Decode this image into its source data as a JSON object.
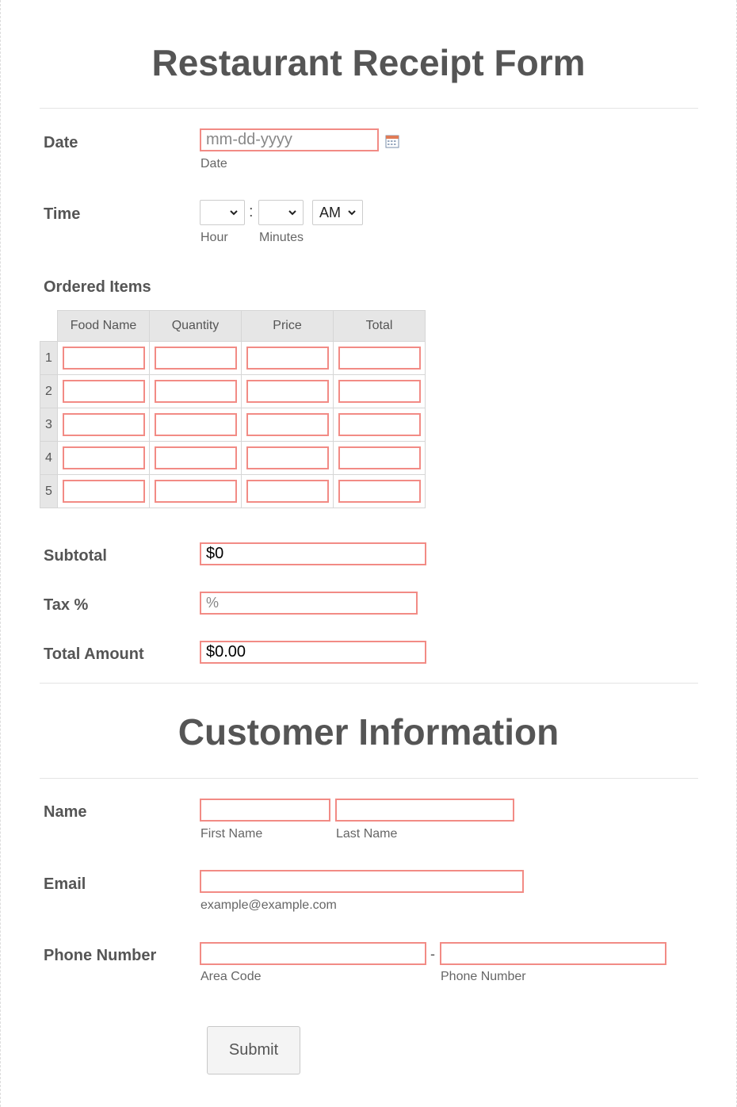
{
  "form": {
    "title": "Restaurant Receipt Form",
    "date": {
      "label": "Date",
      "placeholder": "mm-dd-yyyy",
      "sublabel": "Date"
    },
    "time": {
      "label": "Time",
      "hour_value": "",
      "minutes_value": "",
      "separator": ":",
      "ampm_value": "AM",
      "hour_sublabel": "Hour",
      "minutes_sublabel": "Minutes"
    },
    "ordered_items": {
      "label": "Ordered Items",
      "columns": [
        "Food Name",
        "Quantity",
        "Price",
        "Total"
      ],
      "rows": [
        "1",
        "2",
        "3",
        "4",
        "5"
      ]
    },
    "subtotal": {
      "label": "Subtotal",
      "value": "$0"
    },
    "tax": {
      "label": "Tax %",
      "placeholder": "%"
    },
    "total_amount": {
      "label": "Total Amount",
      "value": "$0.00"
    }
  },
  "customer": {
    "title": "Customer Information",
    "name": {
      "label": "Name",
      "first_sublabel": "First Name",
      "last_sublabel": "Last Name"
    },
    "email": {
      "label": "Email",
      "sublabel": "example@example.com"
    },
    "phone": {
      "label": "Phone Number",
      "separator": "-",
      "area_sublabel": "Area Code",
      "number_sublabel": "Phone Number"
    }
  },
  "submit_label": "Submit",
  "icons": {
    "calendar": "calendar-icon",
    "dropdown": "chevron-down-icon"
  },
  "colors": {
    "input_border": "#f28b85",
    "text": "#555555",
    "header_bg": "#e6e6e6"
  }
}
